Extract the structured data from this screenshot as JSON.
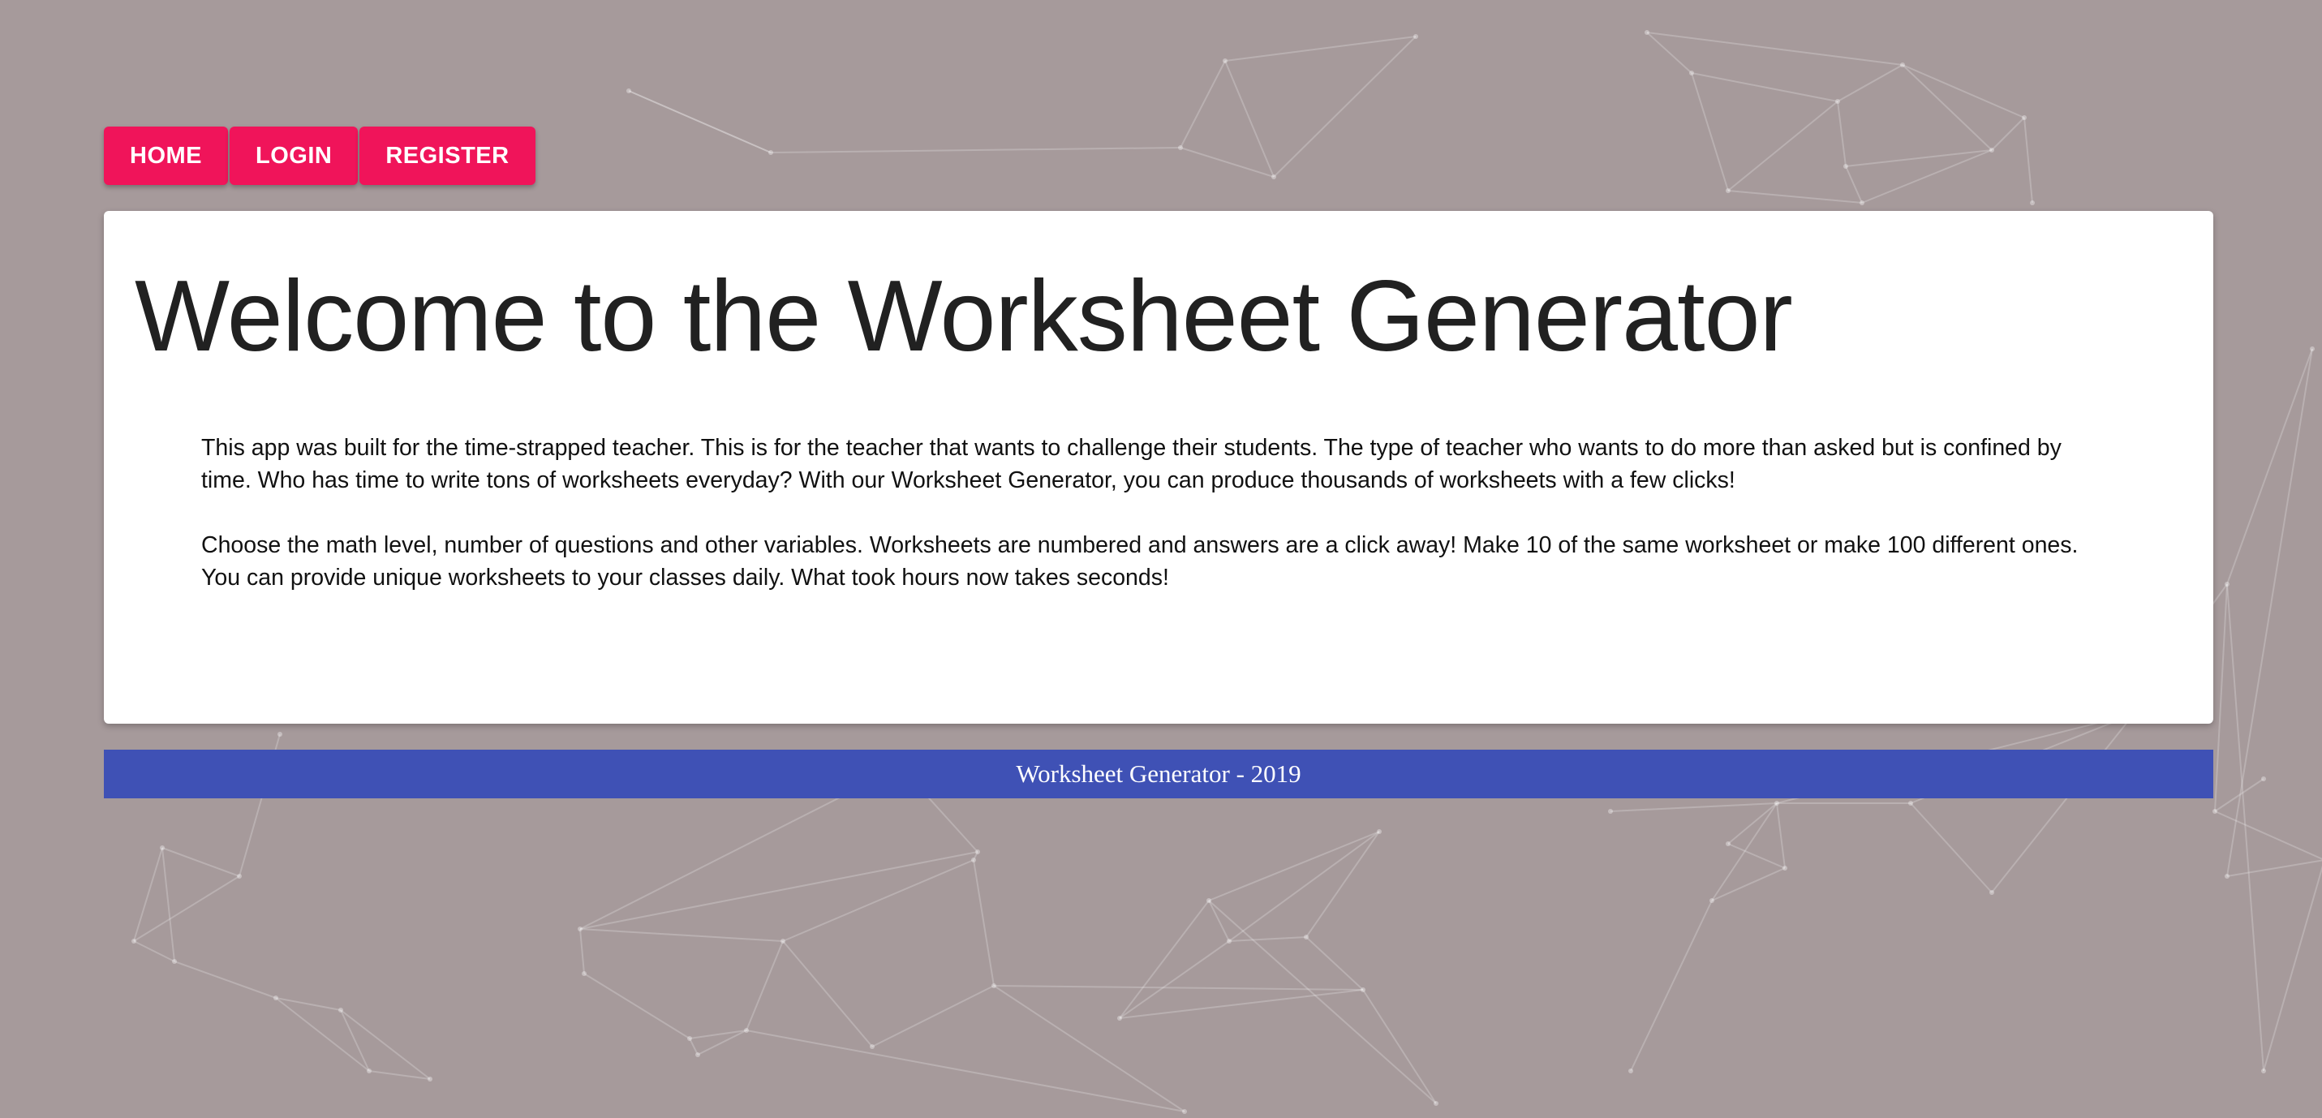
{
  "nav": {
    "home_label": "HOME",
    "login_label": "LOGIN",
    "register_label": "REGISTER"
  },
  "main": {
    "title": "Welcome to the Worksheet Generator",
    "paragraphs": [
      "This app was built for the time-strapped teacher. This is for the teacher that wants to challenge their students. The type of teacher who wants to do more than asked but is confined by time. Who has time to write tons of worksheets everyday? With our Worksheet Generator, you can produce thousands of worksheets with a few clicks!",
      "Choose the math level, number of questions and other variables. Worksheets are numbered and answers are a click away! Make 10 of the same worksheet or make 100 different ones. You can provide unique worksheets to your classes daily. What took hours now takes seconds!"
    ]
  },
  "footer": {
    "text": "Worksheet Generator - 2019"
  },
  "colors": {
    "background": "#a69a9b",
    "nav_button": "#f0145a",
    "footer": "#3f51b5",
    "card": "#ffffff"
  }
}
